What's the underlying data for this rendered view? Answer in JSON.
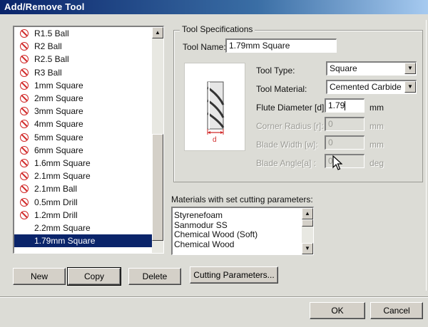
{
  "window": {
    "title": "Add/Remove Tool"
  },
  "tool_list": {
    "items": [
      {
        "label": "R1.5 Ball",
        "icon": "no-entry-icon"
      },
      {
        "label": "R2 Ball",
        "icon": "no-entry-icon"
      },
      {
        "label": "R2.5 Ball",
        "icon": "no-entry-icon"
      },
      {
        "label": "R3 Ball",
        "icon": "no-entry-icon"
      },
      {
        "label": "1mm Square",
        "icon": "no-entry-icon"
      },
      {
        "label": "2mm Square",
        "icon": "no-entry-icon"
      },
      {
        "label": "3mm Square",
        "icon": "no-entry-icon"
      },
      {
        "label": "4mm Square",
        "icon": "no-entry-icon"
      },
      {
        "label": "5mm Square",
        "icon": "no-entry-icon"
      },
      {
        "label": "6mm Square",
        "icon": "no-entry-icon"
      },
      {
        "label": "1.6mm Square",
        "icon": "no-entry-icon"
      },
      {
        "label": "2.1mm Square",
        "icon": "no-entry-icon"
      },
      {
        "label": "2.1mm Ball",
        "icon": "no-entry-icon"
      },
      {
        "label": "0.5mm Drill",
        "icon": "no-entry-icon"
      },
      {
        "label": "1.2mm Drill",
        "icon": "no-entry-icon"
      },
      {
        "label": "2.2mm Square",
        "icon": ""
      },
      {
        "label": "1.79mm Square",
        "icon": "",
        "selected": true
      }
    ]
  },
  "spec": {
    "group_title": "Tool Specifications",
    "tool_name_label": "Tool Name:",
    "tool_name_value": "1.79mm Square",
    "image_dim_label": "d",
    "tool_type_label": "Tool Type:",
    "tool_type_value": "Square",
    "tool_material_label": "Tool Material:",
    "tool_material_value": "Cemented Carbide",
    "flute_label": "Flute Diameter [d]:",
    "flute_value": "1.79",
    "flute_unit": "mm",
    "corner_label": "Corner Radius [r]:",
    "corner_value": "0",
    "corner_unit": "mm",
    "blade_width_label": "Blade Width [w]:",
    "blade_width_value": "0",
    "blade_width_unit": "mm",
    "blade_angle_label": "Blade Angle[a] :",
    "blade_angle_value": "0",
    "blade_angle_unit": "deg"
  },
  "materials": {
    "label": "Materials with set cutting parameters:",
    "items": [
      "Styrenefoam",
      "Sanmodur SS",
      "Chemical Wood (Soft)",
      "Chemical Wood"
    ]
  },
  "buttons": {
    "new": "New",
    "copy": "Copy",
    "delete": "Delete",
    "cutting": "Cutting Parameters...",
    "ok": "OK",
    "cancel": "Cancel"
  },
  "colors": {
    "selection": "#0a246a",
    "no_entry": "#d12a2a",
    "dimension": "#d12a2a"
  }
}
